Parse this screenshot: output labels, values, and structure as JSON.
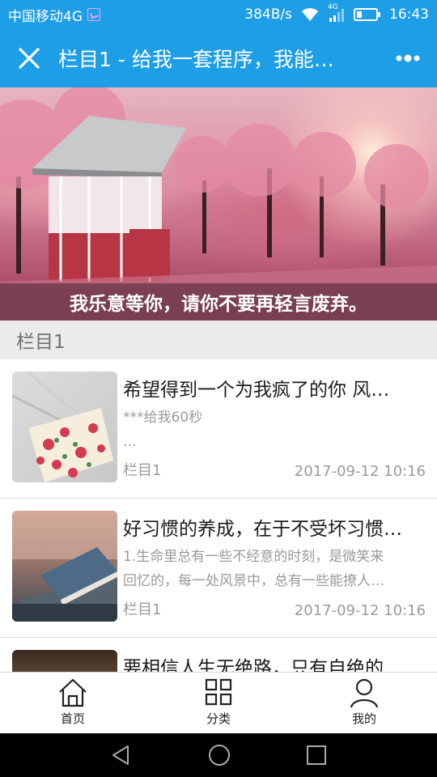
{
  "status_bar": {
    "carrier": "中国移动4G",
    "speed": "384B/s",
    "network_badge": "4G",
    "time": "16:43"
  },
  "nav": {
    "title": "栏目1 - 给我一套程序，我能…",
    "close_icon": "close-icon",
    "more_icon": "more-dots-icon"
  },
  "banner": {
    "caption": "我乐意等你，请你不要再轻言废弃。"
  },
  "section": {
    "title": "栏目1"
  },
  "articles": [
    {
      "title": "希望得到一个为我疯了的你 风…",
      "summary_line1": "***给我60秒",
      "summary_line2": "…",
      "category": "栏目1",
      "time": "2017-09-12 10:16"
    },
    {
      "title": "好习惯的养成，在于不受坏习惯…",
      "summary_line1": "1.生命里总有一些不经意的时刻，是微笑来",
      "summary_line2": "回忆的，每一处风景中，总有一些能撩人…",
      "category": "栏目1",
      "time": "2017-09-12 10:16"
    },
    {
      "title": "要相信人生无绝路，只有自绝的…"
    }
  ],
  "tabs": [
    {
      "label": "首页",
      "icon": "home-icon"
    },
    {
      "label": "分类",
      "icon": "grid-icon"
    },
    {
      "label": "我的",
      "icon": "user-icon"
    }
  ],
  "colors": {
    "primary": "#1e9ee6",
    "section_bg": "#ebebeb",
    "muted_text": "#9a9a9a"
  }
}
